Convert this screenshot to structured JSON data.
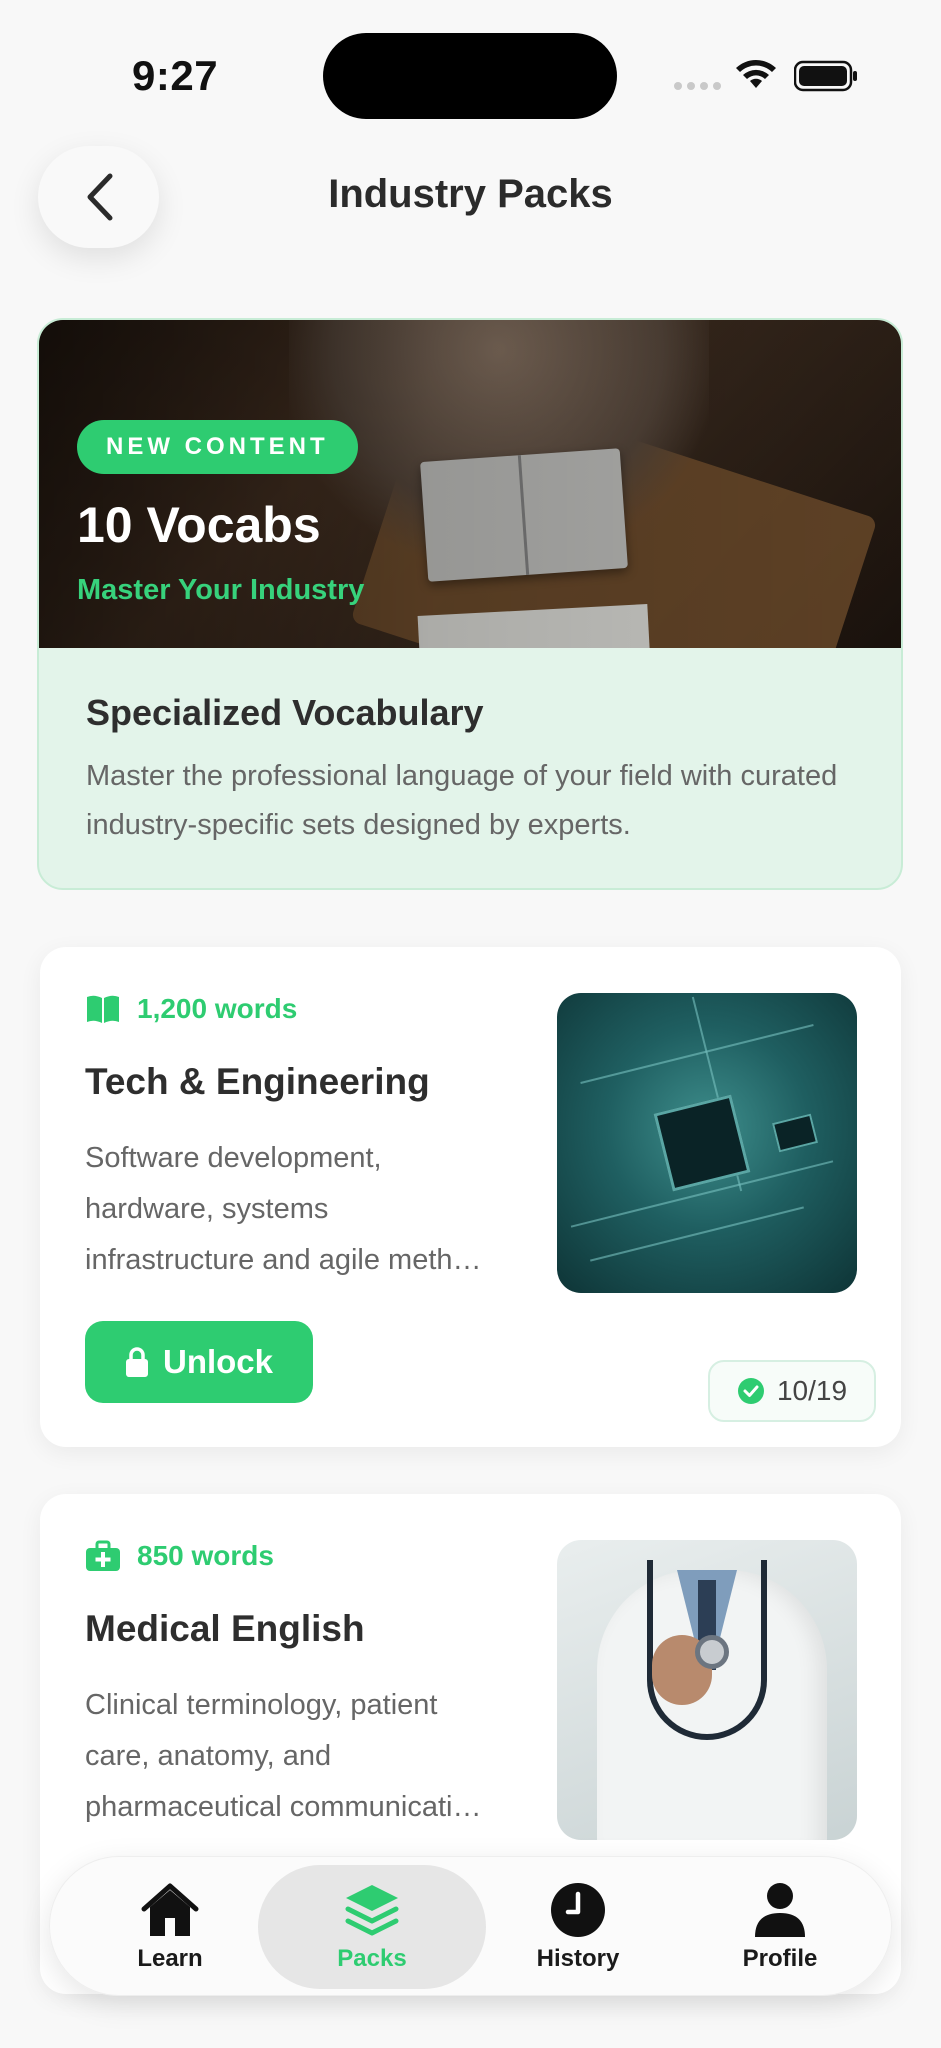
{
  "status_bar": {
    "time": "9:27"
  },
  "header": {
    "title": "Industry Packs"
  },
  "hero": {
    "badge": "NEW CONTENT",
    "title": "10 Vocabs",
    "subtitle": "Master Your Industry",
    "heading": "Specialized Vocabulary",
    "description": "Master the professional language of your field with curated industry-specific sets designed by experts."
  },
  "packs": [
    {
      "count": "1,200 words",
      "icon": "book-open-icon",
      "title": "Tech & Engineering",
      "description_lines": [
        "Software development,",
        "hardware, systems",
        "infrastructure and agile meth…"
      ],
      "unlock_label": "Unlock",
      "progress": "10/19"
    },
    {
      "count": "850 words",
      "icon": "medical-kit-icon",
      "title": "Medical English",
      "description_lines": [
        "Clinical terminology, patient",
        "care, anatomy, and",
        "pharmaceutical communicati…"
      ]
    }
  ],
  "tabs": [
    {
      "label": "Learn",
      "icon": "home-icon"
    },
    {
      "label": "Packs",
      "icon": "layers-icon",
      "active": true
    },
    {
      "label": "History",
      "icon": "clock-icon"
    },
    {
      "label": "Profile",
      "icon": "person-icon"
    }
  ],
  "colors": {
    "accent": "#2ecc71",
    "background": "#f8f8f8",
    "hero_panel": "#e3f4ea"
  }
}
